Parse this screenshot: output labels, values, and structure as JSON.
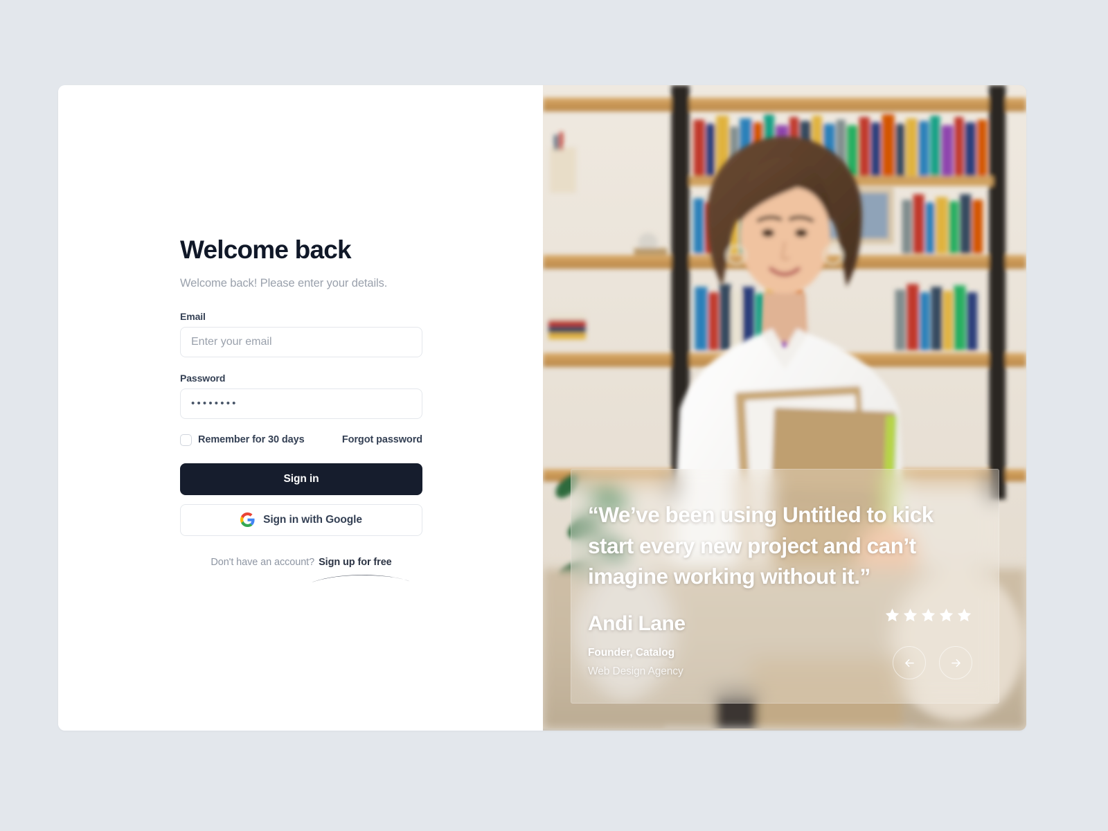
{
  "theme": {
    "page_background": "#e3e7ec",
    "panel_background": "#ffffff",
    "primary_button": "#161d2d",
    "heading_color": "#101828",
    "muted_text": "#9aa1ac",
    "border_color": "#e4e7ec"
  },
  "form": {
    "title": "Welcome back",
    "subtitle": "Welcome back! Please enter your details.",
    "email": {
      "label": "Email",
      "placeholder": "Enter your email",
      "value": ""
    },
    "password": {
      "label": "Password",
      "value": "••••••••",
      "masked_char_count": 8
    },
    "remember": {
      "label": "Remember for 30 days",
      "checked": false
    },
    "forgot_label": "Forgot password",
    "sign_in_label": "Sign in",
    "google_label": "Sign in with Google",
    "signup_prompt": "Don't have an account?",
    "signup_link": "Sign up for free"
  },
  "testimonial": {
    "quote": "“We’ve been using Untitled to kick start every new project and can’t imagine working without it.”",
    "author": "Andi Lane",
    "role": "Founder, Catalog",
    "company": "Web Design Agency",
    "rating": 5,
    "rating_max": 5,
    "prev_label": "Previous testimonial",
    "next_label": "Next testimonial"
  },
  "photo": {
    "description": "Smiling woman in white shirt holding kraft folders in front of wooden bookshelves"
  }
}
